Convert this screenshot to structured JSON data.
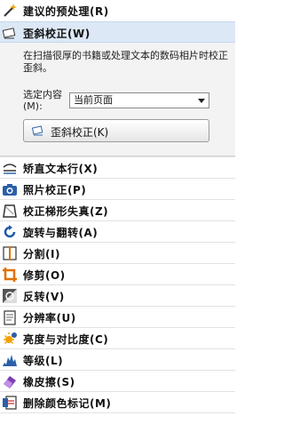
{
  "menu_top": [
    {
      "label": "建议的预处理(R)",
      "icon": "wand-icon"
    },
    {
      "label": "歪斜校正(W)",
      "icon": "deskew-icon"
    }
  ],
  "deskew_panel": {
    "description": "在扫描很厚的书籍或处理文本的数码相片时校正歪斜。",
    "select_label": "选定内容(M):",
    "select_value": "当前页面",
    "button_label": "歪斜校正(K)"
  },
  "menu_items": [
    {
      "label": "矫直文本行(X)",
      "icon": "straighten-lines-icon"
    },
    {
      "label": "照片校正(P)",
      "icon": "camera-icon"
    },
    {
      "label": "校正梯形失真(Z)",
      "icon": "trapezoid-icon"
    },
    {
      "label": "旋转与翻转(A)",
      "icon": "rotate-icon"
    },
    {
      "label": "分割(I)",
      "icon": "split-icon"
    },
    {
      "label": "修剪(O)",
      "icon": "crop-icon"
    },
    {
      "label": "反转(V)",
      "icon": "invert-icon"
    },
    {
      "label": "分辨率(U)",
      "icon": "resolution-icon"
    },
    {
      "label": "亮度与对比度(C)",
      "icon": "brightness-icon"
    },
    {
      "label": "等级(L)",
      "icon": "levels-icon"
    },
    {
      "label": "橡皮擦(S)",
      "icon": "eraser-icon"
    },
    {
      "label": "删除颜色标记(M)",
      "icon": "remove-color-marks-icon"
    }
  ]
}
